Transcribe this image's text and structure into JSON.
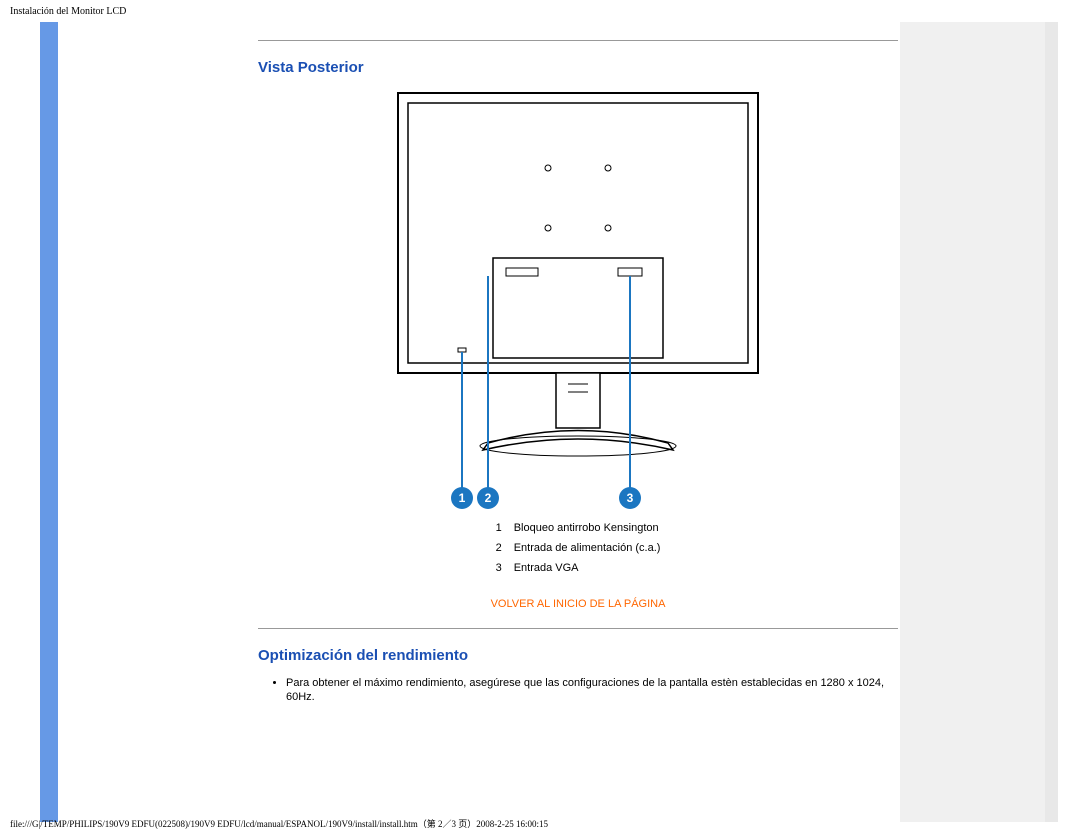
{
  "page": {
    "header_title": "Instalación del Monitor LCD",
    "footer_text": "file:///G|/TEMP/PHILIPS/190V9 EDFU(022508)/190V9 EDFU/lcd/manual/ESPANOL/190V9/install/install.htm（第 2／3 页）2008-2-25 16:00:15"
  },
  "sections": {
    "rear_view": {
      "title": "Vista Posterior",
      "legend": [
        {
          "num": "1",
          "label": "Bloqueo antirrobo Kensington"
        },
        {
          "num": "2",
          "label": "Entrada de alimentación (c.a.)"
        },
        {
          "num": "3",
          "label": "Entrada VGA"
        }
      ]
    },
    "return_link": "VOLVER AL INICIO DE LA PÁGINA",
    "performance": {
      "title": "Optimización del rendimiento",
      "bullet": "Para obtener el máximo rendimiento, asegúrese que las configuraciones de la pantalla estèn establecidas en 1280 x 1024, 60Hz."
    }
  }
}
